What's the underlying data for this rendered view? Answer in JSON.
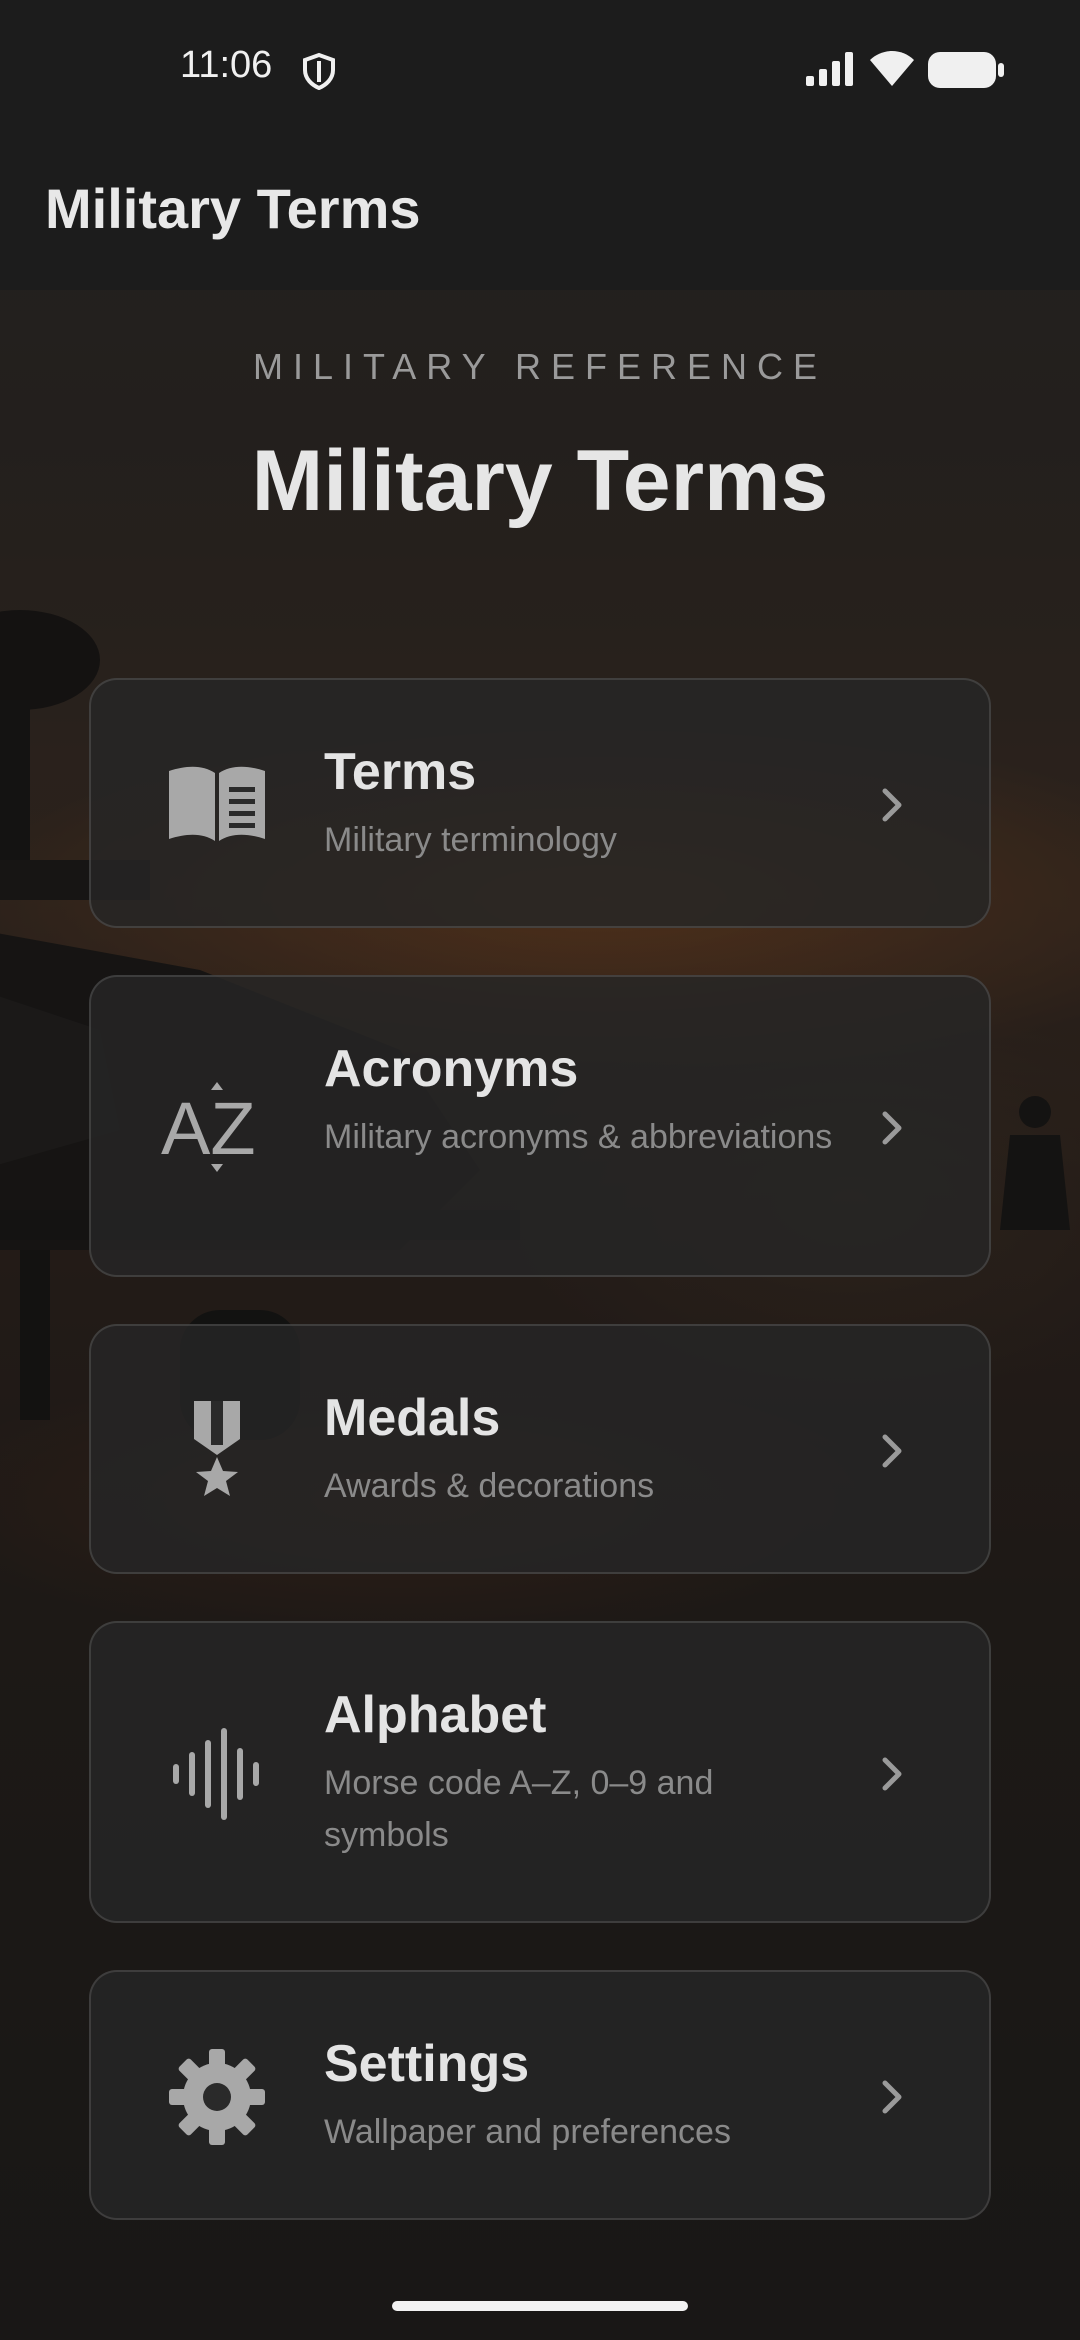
{
  "status_bar": {
    "time": "11:06"
  },
  "app_bar": {
    "title": "Military Terms"
  },
  "hero": {
    "overline": "MILITARY REFERENCE",
    "title": "Military Terms"
  },
  "menu": [
    {
      "title": "Terms",
      "subtitle": "Military terminology",
      "icon": "book-icon"
    },
    {
      "title": "Acronyms",
      "subtitle": "Military acronyms & abbreviations",
      "icon": "sort-az-icon"
    },
    {
      "title": "Medals",
      "subtitle": "Awards & decorations",
      "icon": "medal-icon"
    },
    {
      "title": "Alphabet",
      "subtitle": "Morse code A–Z, 0–9 and symbols",
      "icon": "waveform-icon"
    },
    {
      "title": "Settings",
      "subtitle": "Wallpaper and preferences",
      "icon": "gear-icon"
    }
  ],
  "colors": {
    "background": "#161616",
    "bar": "#1c1c1c",
    "card": "#262626",
    "text_primary": "#e4e4e4",
    "text_secondary": "#8a8a8a",
    "icon": "#a8a8a8"
  }
}
